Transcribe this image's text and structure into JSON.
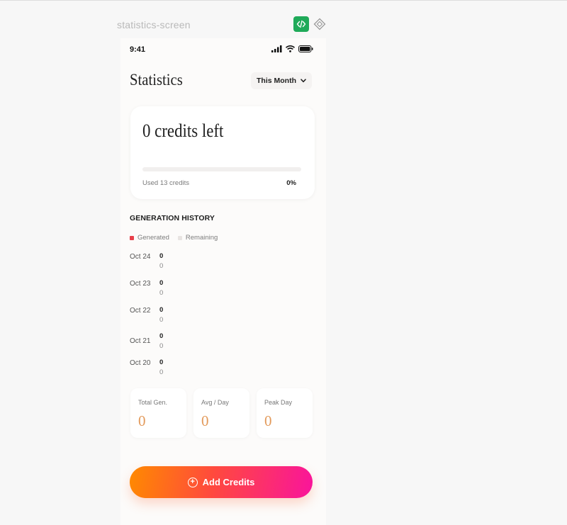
{
  "frame": {
    "title": "statistics-screen"
  },
  "status": {
    "time": "9:41"
  },
  "header": {
    "title": "Statistics",
    "period": "This Month"
  },
  "credits": {
    "title": "0 credits left",
    "used_label": "Used 13 credits",
    "percent_label": "0%",
    "progress_fraction": 0
  },
  "history": {
    "title": "GENERATION HISTORY",
    "legend": {
      "generated": "Generated",
      "remaining": "Remaining",
      "generated_color": "#e8404a",
      "remaining_color": "#e8e4e2"
    },
    "rows": [
      {
        "date": "Oct 24",
        "generated": "0",
        "remaining": "0"
      },
      {
        "date": "Oct 23",
        "generated": "0",
        "remaining": "0"
      },
      {
        "date": "Oct 22",
        "generated": "0",
        "remaining": "0"
      },
      {
        "date": "Oct 21",
        "generated": "0",
        "remaining": "0"
      },
      {
        "date": "Oct 20",
        "generated": "0",
        "remaining": "0"
      }
    ]
  },
  "stats": [
    {
      "label": "Total Gen.",
      "value": "0"
    },
    {
      "label": "Avg / Day",
      "value": "0"
    },
    {
      "label": "Peak Day",
      "value": "0"
    }
  ],
  "cta": {
    "label": "Add Credits"
  },
  "colors": {
    "accent_start": "#ff8a00",
    "accent_end": "#f9149c",
    "code_badge": "#1faa59"
  },
  "icons": [
    "code-icon",
    "component-diamond-icon",
    "cellular-signal-icon",
    "wifi-icon",
    "battery-icon",
    "chevron-down-icon",
    "plus-circle-icon"
  ]
}
